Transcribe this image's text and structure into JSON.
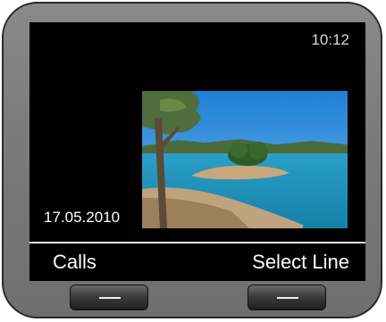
{
  "status": {
    "time": "10:12"
  },
  "screensaver": {
    "date": "17.05.2010",
    "image": "lake-landscape-photo"
  },
  "softkeys": {
    "left_label": "Calls",
    "right_label": "Select Line"
  },
  "colors": {
    "screen_bg": "#000000",
    "frame": "#7f7f7f",
    "text": "#ffffff"
  },
  "icons": {
    "left_key": "dash-key-icon",
    "right_key": "dash-key-icon"
  }
}
